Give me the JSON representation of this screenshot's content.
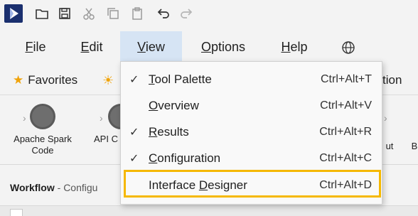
{
  "toolbar": {
    "icons": [
      "app-logo-icon",
      "open-folder-icon",
      "save-icon",
      "cut-icon",
      "copy-icon",
      "paste-icon",
      "undo-icon",
      "redo-icon"
    ]
  },
  "menubar": {
    "file": {
      "mnemonic": "F",
      "rest": "ile"
    },
    "edit": {
      "mnemonic": "E",
      "rest": "dit"
    },
    "view": {
      "mnemonic": "V",
      "rest": "iew"
    },
    "options": {
      "mnemonic": "O",
      "rest": "ptions"
    },
    "help": {
      "mnemonic": "H",
      "rest": "elp"
    },
    "globe_icon": "globe-icon"
  },
  "tabs": {
    "favorites": "Favorites",
    "partial_right": "tion"
  },
  "palette": {
    "tools": [
      {
        "label_line1": "Apache Spark",
        "label_line2": "Code"
      },
      {
        "label_line1": "API C",
        "label_line2": ""
      },
      {
        "label_line1": "ut",
        "label_line2": ""
      },
      {
        "label_line1": "B",
        "label_line2": ""
      }
    ]
  },
  "workflow": {
    "title": "Workflow",
    "subtitle": "- Configu"
  },
  "view_menu": {
    "items": [
      {
        "checked": true,
        "before": "",
        "mnemonic": "T",
        "after": "ool Palette",
        "shortcut": "Ctrl+Alt+T"
      },
      {
        "checked": false,
        "before": "",
        "mnemonic": "O",
        "after": "verview",
        "shortcut": "Ctrl+Alt+V"
      },
      {
        "checked": true,
        "before": "",
        "mnemonic": "R",
        "after": "esults",
        "shortcut": "Ctrl+Alt+R"
      },
      {
        "checked": true,
        "before": "",
        "mnemonic": "C",
        "after": "onfiguration",
        "shortcut": "Ctrl+Alt+C"
      },
      {
        "checked": false,
        "before": "Interface ",
        "mnemonic": "D",
        "after": "esigner",
        "shortcut": "Ctrl+Alt+D"
      }
    ],
    "highlight_color": "#f5b800"
  }
}
